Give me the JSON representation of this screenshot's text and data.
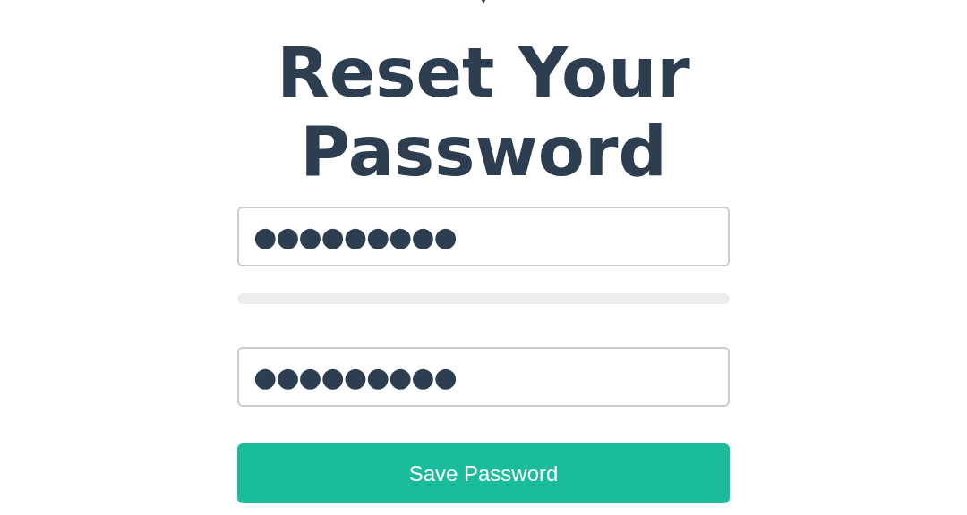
{
  "title": "Reset Your Password",
  "password": {
    "value": "●●●●●●●●●"
  },
  "strength": {
    "level": 0
  },
  "confirm": {
    "value": "●●●●●●●●●"
  },
  "button": {
    "label": "Save Password"
  }
}
